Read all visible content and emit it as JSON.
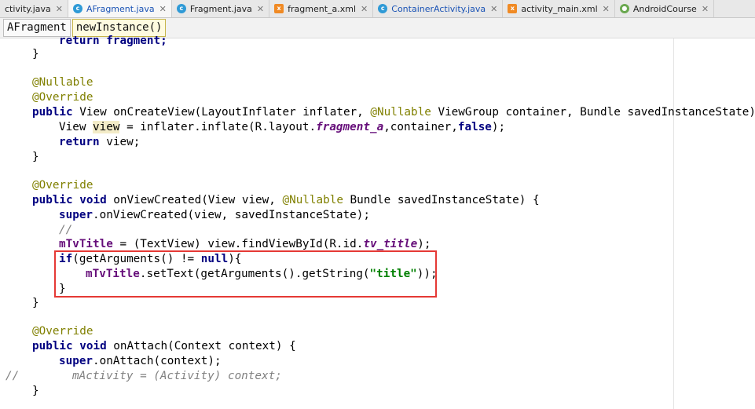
{
  "tabs": [
    {
      "label": "ctivity.java",
      "icon": "none",
      "active": false
    },
    {
      "label": "AFragment.java",
      "icon": "class-icon",
      "active": true
    },
    {
      "label": "Fragment.java",
      "icon": "class-icon",
      "active": false
    },
    {
      "label": "fragment_a.xml",
      "icon": "xml-icon",
      "active": false
    },
    {
      "label": "ContainerActivity.java",
      "icon": "class-icon",
      "active": false
    },
    {
      "label": "activity_main.xml",
      "icon": "xml-icon",
      "active": false
    },
    {
      "label": "AndroidCourse",
      "icon": "module-icon",
      "active": false
    }
  ],
  "breadcrumb": {
    "class": "AFragment",
    "method": "newInstance()"
  },
  "code": {
    "l0": "return fragment;",
    "l1": "}",
    "l2_ann": "@Nullable",
    "l3_ann": "@Override",
    "l4": {
      "kw": "public",
      "a": " View onCreateView(LayoutInflater inflater, ",
      "ann": "@Nullable",
      "b": " ViewGroup container, Bundle savedInstanceState) {"
    },
    "l5": {
      "a": "View ",
      "var": "view",
      "b": " = inflater.inflate(R.layout.",
      "fld": "fragment_a",
      "c": ",container,",
      "kw": "false",
      "d": ");"
    },
    "l6": {
      "kw": "return",
      "a": " view;"
    },
    "l7": "}",
    "l8_ann": "@Override",
    "l9": {
      "kw": "public void",
      "a": " onViewCreated(View view, ",
      "ann": "@Nullable",
      "b": " Bundle savedInstanceState) {"
    },
    "l10": {
      "kw": "super",
      "a": ".onViewCreated(view, savedInstanceState);"
    },
    "l11": "//",
    "l12": {
      "fld": "mTvTitle",
      "a": " = (TextView) view.findViewById(R.id.",
      "it": "tv_title",
      "b": ");"
    },
    "l13": {
      "kw": "if",
      "a": "(getArguments() != ",
      "kw2": "null",
      "b": "){"
    },
    "l14": {
      "fld": "mTvTitle",
      "a": ".setText(getArguments().getString(",
      "str": "\"title\"",
      "b": "));"
    },
    "l15": "}",
    "l16": "}",
    "l17_ann": "@Override",
    "l18": {
      "kw": "public void",
      "a": " onAttach(Context context) {"
    },
    "l19": {
      "kw": "super",
      "a": ".onAttach(context);"
    },
    "l20": {
      "prefix": "//",
      "body": "mActivity = (Activity) context;"
    },
    "l21": "}"
  }
}
